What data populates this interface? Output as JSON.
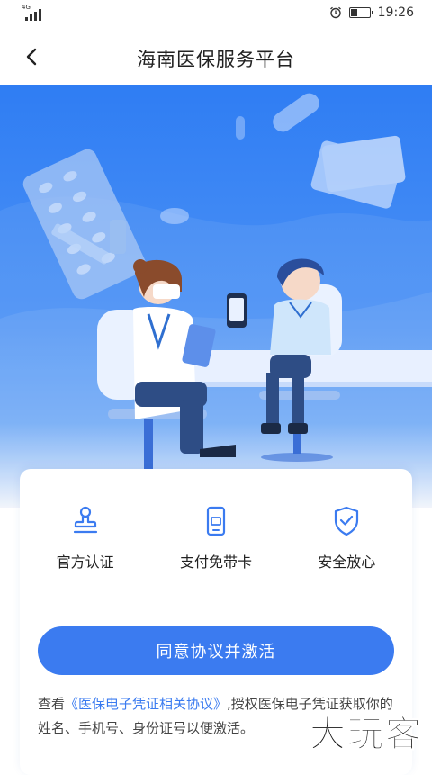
{
  "status_bar": {
    "network": "4G",
    "time": "19:26",
    "battery_level": 0.35,
    "icons": [
      "signal-icon",
      "alarm-icon",
      "battery-icon"
    ]
  },
  "nav": {
    "back_icon": "chevron-left-icon",
    "title": "海南医保服务平台"
  },
  "features": [
    {
      "icon": "stamp-icon",
      "label": "官方认证"
    },
    {
      "icon": "phone-card-icon",
      "label": "支付免带卡"
    },
    {
      "icon": "shield-check-icon",
      "label": "安全放心"
    }
  ],
  "activate_button": "同意协议并激活",
  "agreement": {
    "prefix": "查看",
    "link": "《医保电子凭证相关协议》",
    "suffix": ",授权医保电子凭证获取你的姓名、手机号、身份证号以便激活。"
  },
  "watermark": "大玩客",
  "colors": {
    "accent": "#3b7bf0",
    "hero_top": "#2f7df3",
    "hero_bottom": "#6aa6f6"
  }
}
